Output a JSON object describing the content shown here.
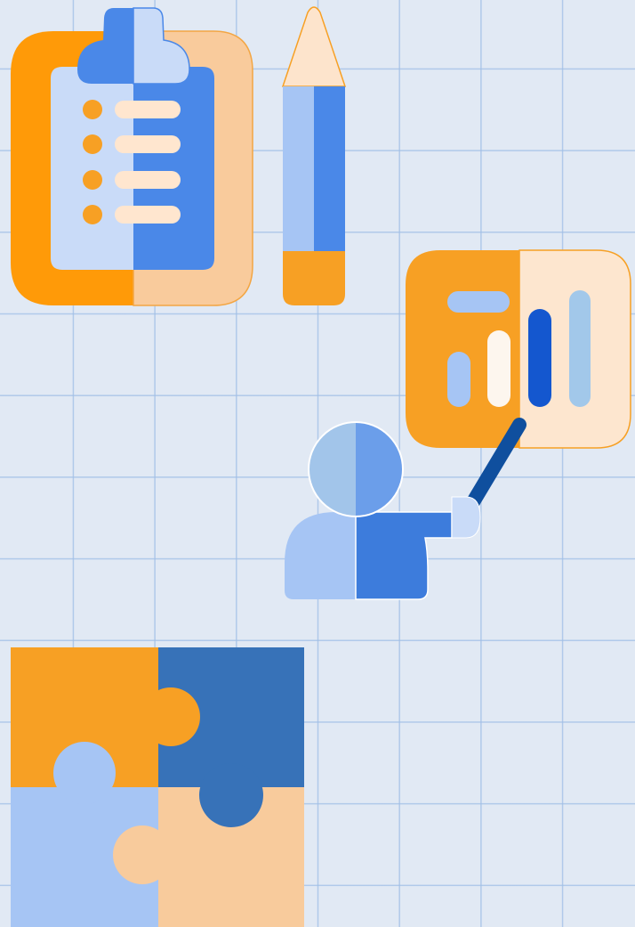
{
  "scene": {
    "background_color": "#e1e9f4",
    "grid_color": "#a9c3e8",
    "illustrations": [
      {
        "name": "clipboard-icon",
        "colors": [
          "#ff9a08",
          "#f9cb9c",
          "#c9dbf8",
          "#4a88e8",
          "#ffe6cf"
        ]
      },
      {
        "name": "pencil-icon",
        "colors": [
          "#fde4cc",
          "#a6c5f4",
          "#4a88e8",
          "#f7a024"
        ]
      },
      {
        "name": "presentation-board-icon",
        "colors": [
          "#f7a024",
          "#fde6cf",
          "#a6c5f4",
          "#1457cf",
          "#a2c8ea"
        ]
      },
      {
        "name": "presenter-person-icon",
        "colors": [
          "#a2c5ea",
          "#6b9eea",
          "#a6c5f4",
          "#3d7cdc",
          "#0f4f9e"
        ]
      },
      {
        "name": "puzzle-icon",
        "colors": [
          "#f7a024",
          "#3772b8",
          "#a6c5f4",
          "#f8cb9c"
        ]
      }
    ]
  }
}
